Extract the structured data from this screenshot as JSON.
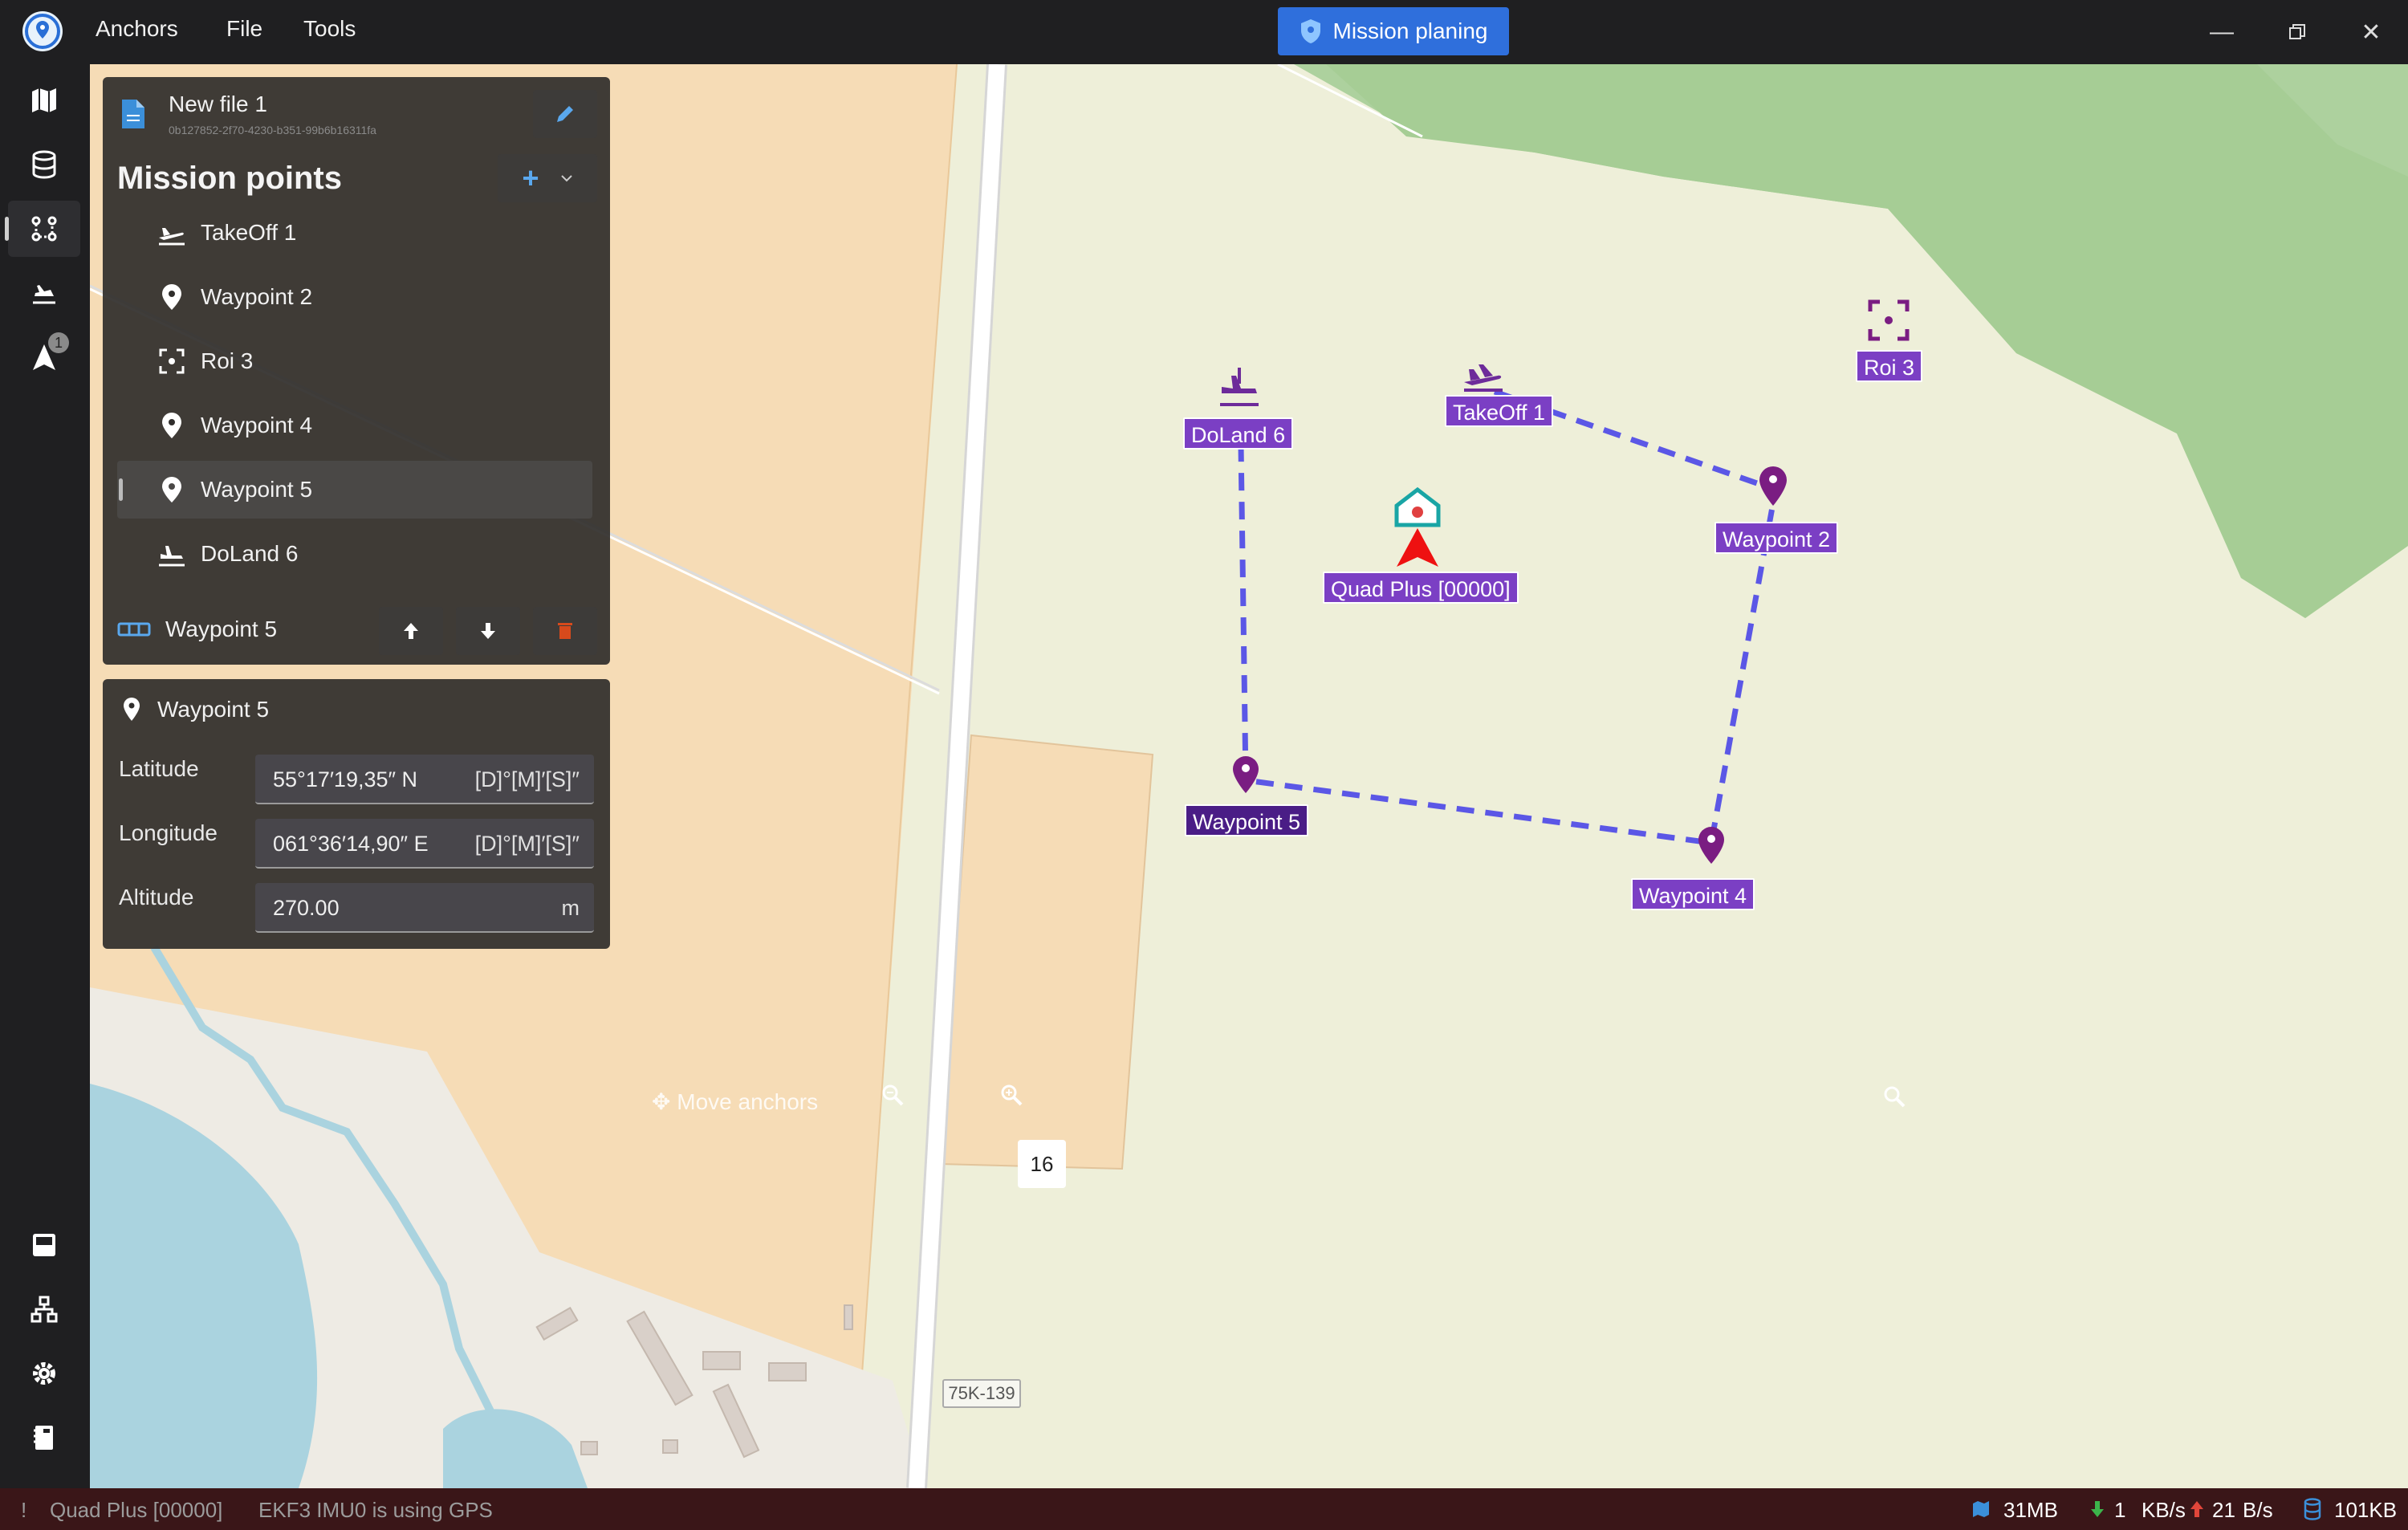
{
  "app": {
    "menu": [
      "Anchors",
      "File",
      "Tools"
    ],
    "mode_button": "Mission planing"
  },
  "rail": {
    "notification_count": "1"
  },
  "file": {
    "title": "New file 1",
    "guid": "0b127852-2f70-4230-b351-99b6b16311fa"
  },
  "mission": {
    "title": "Mission points",
    "items": [
      {
        "label": "TakeOff 1",
        "icon": "takeoff-icon"
      },
      {
        "label": "Waypoint 2",
        "icon": "map-pin-icon"
      },
      {
        "label": "Roi 3",
        "icon": "roi-icon"
      },
      {
        "label": "Waypoint 4",
        "icon": "map-pin-icon"
      },
      {
        "label": "Waypoint 5",
        "icon": "map-pin-icon",
        "selected": true
      },
      {
        "label": "DoLand 6",
        "icon": "landing-icon"
      }
    ],
    "selected_label": "Waypoint 5"
  },
  "details": {
    "title": "Waypoint 5",
    "latitude_label": "Latitude",
    "latitude_value": "55°17′19,35″ N",
    "latitude_unit": "[D]°[M]′[S]″",
    "longitude_label": "Longitude",
    "longitude_value": "061°36′14,90″ E",
    "longitude_unit": "[D]°[M]′[S]″",
    "altitude_label": "Altitude",
    "altitude_value": "270.00",
    "altitude_unit": "m"
  },
  "map": {
    "markers": {
      "takeoff": "TakeOff 1",
      "wp2": "Waypoint 2",
      "roi": "Roi 3",
      "wp4": "Waypoint 4",
      "wp5": "Waypoint 5",
      "doland": "DoLand 6",
      "vehicle": "Quad Plus [00000]"
    },
    "move_anchors": "Move anchors",
    "zoom_level": "16",
    "road_sign": "75K-139",
    "path_color": "#5b57e6",
    "marker_color": "#7b3fc4"
  },
  "status": {
    "alert": "!",
    "vehicle": "Quad Plus [00000]",
    "message": "EKF3 IMU0 is using GPS",
    "map_cache": "31MB",
    "down_value": "1",
    "down_unit": "KB/s",
    "up_value": "21",
    "up_unit": "B/s",
    "db_size": "101KB"
  }
}
